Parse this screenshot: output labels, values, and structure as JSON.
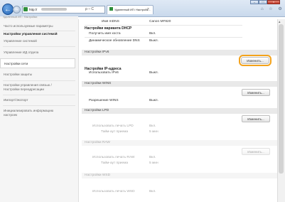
{
  "browser": {
    "url_prefix": "http://",
    "addr_tools": "ρ – C",
    "tab_title": "Удаленный ИП: Настройк...",
    "tab_close": "×",
    "win_min": "–",
    "win_max": "□",
    "win_close": "×",
    "chrome_icons": "⌂ ☆ ⚙"
  },
  "breadcrumb": "Удаленный ИП › Настройки",
  "sidebar": {
    "items": [
      {
        "label": "Часто используемые параметры"
      },
      {
        "label": "Настройки управления системой"
      },
      {
        "label": "Управление системой"
      },
      {
        "label": "Управление ИД отдела"
      },
      {
        "label": "Настройки сети"
      },
      {
        "label": "Настройки защиты"
      },
      {
        "label": "Настройки управления связью /"
      },
      {
        "label": "Настройки переадресации"
      },
      {
        "label": "Импорт/Экспорт"
      },
      {
        "label": "Инициализировать информацию"
      },
      {
        "label": "настроек"
      }
    ]
  },
  "top": {
    "mdns_label": "Имя mDNS",
    "mdns_value": "Canon MF820",
    "dhcp_title": "Настройки варианта DHCP",
    "hostname_label": "Получить имя хоста",
    "hostname_value": "Вкл.",
    "dns_label": "Динамическое обновление DNS",
    "dns_value": "Выкл."
  },
  "sections": {
    "ipv6": {
      "title": "Настройки IPv6",
      "button": "Изменить...",
      "sub": "Настройки IP-адреса",
      "row_label": "Использовать IPv6",
      "row_value": "Выкл."
    },
    "wins": {
      "title": "Настройки WINS",
      "button": "Изменить...",
      "row_label": "Разрешение WINS",
      "row_value": "Выкл."
    },
    "lpd": {
      "title": "Настройки LPD",
      "button": "Изменить...",
      "row1_label": "Использовать печать LPD",
      "row1_value": "Вкл.",
      "row2_label": "Тайм-аут приема",
      "row2_value": "5 мин"
    },
    "raw": {
      "title": "Настройки RAW",
      "button": "Изменить...",
      "row1_label": "Использовать печать RAW",
      "row1_value": "Вкл.",
      "row2_label": "Тайм-аут приема",
      "row2_value": "5 мин"
    },
    "wsd": {
      "title": "Настройки WSD",
      "row1_label": "Использовать печать WSD",
      "row1_value": "Вкл."
    }
  }
}
